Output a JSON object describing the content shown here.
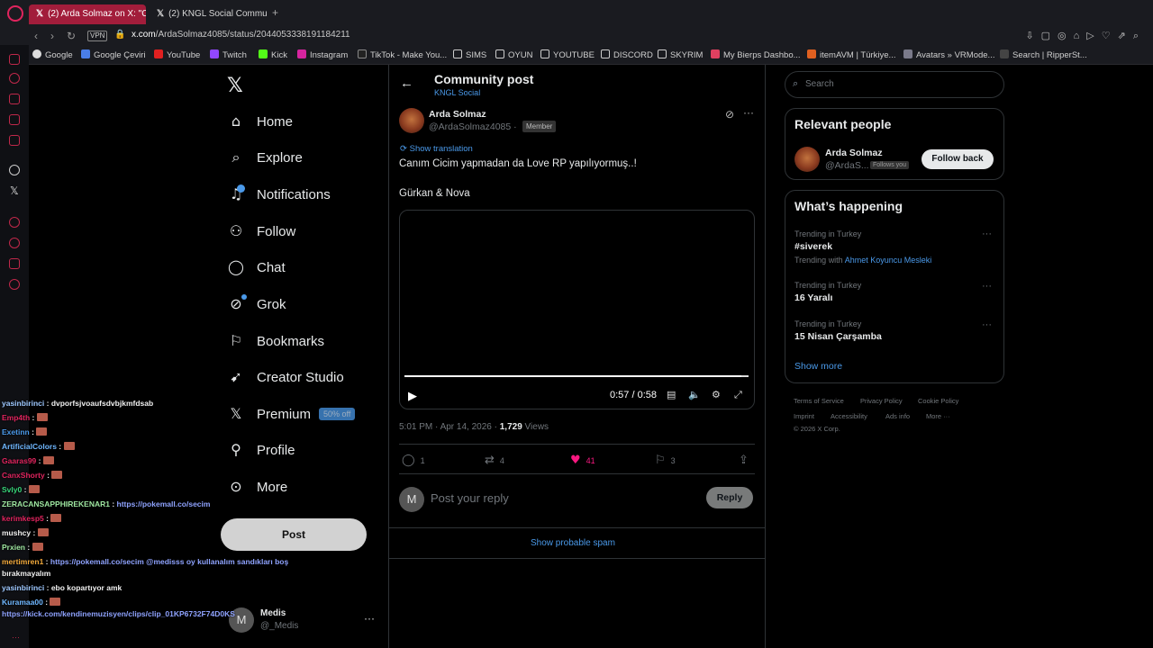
{
  "browser": {
    "tabs": [
      {
        "label": "(2) Arda Solmaz on X: \"Ca",
        "active": true
      },
      {
        "label": "(2) KNGL Social Communi",
        "active": false
      }
    ],
    "vpn": "VPN",
    "url_host": "x.com",
    "url_path": "/ArdaSolmaz4085/status/2044053338191184211",
    "bookmarks": [
      "Google",
      "Google Çeviri",
      "YouTube",
      "Twitch",
      "Kick",
      "Instagram",
      "TikTok - Make You...",
      "SIMS",
      "OYUN",
      "YOUTUBE",
      "DISCORD",
      "SKYRIM",
      "My Bierps Dashbo...",
      "itemAVM | Türkiye...",
      "Avatars » VRMode...",
      "Search | RipperSt..."
    ]
  },
  "nav": {
    "items": [
      "Home",
      "Explore",
      "Notifications",
      "Follow",
      "Chat",
      "Grok",
      "Bookmarks",
      "Creator Studio",
      "Premium",
      "Profile",
      "More"
    ],
    "premium_badge": "50% off",
    "post_button": "Post",
    "account_initial": "M",
    "account_name": "Medis",
    "account_handle": "@_Medis"
  },
  "post": {
    "header_title": "Community post",
    "header_sub": "KNGL Social",
    "author_name": "Arda Solmaz",
    "author_handle": "@ArdaSolmaz4085 ·",
    "member_badge": "Member",
    "show_translation": "Show translation",
    "text1": "Canım Cicim yapmadan da Love RP yapılıyormuş..!",
    "text2": "Gürkan & Nova",
    "video_time": "0:57 / 0:58",
    "video_progress": 0.98,
    "timestamp": "5:01 PM · Apr 14, 2026 ·",
    "views_count": "1,729",
    "views_label": "Views",
    "replies": "1",
    "reposts": "4",
    "likes": "41",
    "bookmarks": "3",
    "reply_initial": "M",
    "reply_placeholder": "Post your reply",
    "reply_button": "Reply",
    "show_spam": "Show probable spam"
  },
  "right": {
    "search_placeholder": "Search",
    "relevant_title": "Relevant people",
    "rp_name": "Arda Solmaz",
    "rp_handle": "@ArdaS...",
    "follows_you": "Follows you",
    "follow_back": "Follow back",
    "happening_title": "What’s happening",
    "trends": [
      {
        "category": "Trending in Turkey",
        "name": "#siverek",
        "with_label": "Trending with",
        "with_value": "Ahmet Koyuncu Mesleki"
      },
      {
        "category": "Trending in Turkey",
        "name": "16 Yaralı"
      },
      {
        "category": "Trending in Turkey",
        "name": "15 Nisan Çarşamba"
      }
    ],
    "show_more": "Show more",
    "footer": [
      "Terms of Service",
      "Privacy Policy",
      "Cookie Policy",
      "Imprint",
      "Accessibility",
      "Ads info",
      "More ···",
      "© 2026 X Corp."
    ]
  },
  "chat": [
    {
      "user": "yasinbirinci",
      "color": "#9ec8ff",
      "msg": "dvporfsjvoaufsdvbjkmfdsab"
    },
    {
      "user": "Emp4th",
      "color": "#e0245e",
      "msg": ""
    },
    {
      "user": "Exetinn",
      "color": "#4a99e9",
      "msg": ""
    },
    {
      "user": "ArtificialColors",
      "color": "#6fb7ff",
      "msg": ""
    },
    {
      "user": "Gaaras99",
      "color": "#e0245e",
      "msg": ""
    },
    {
      "user": "CanxShorty",
      "color": "#e0245e",
      "msg": ""
    },
    {
      "user": "Svly0",
      "color": "#37d67a",
      "msg": ""
    },
    {
      "user": "ZERACANSAPPHIREKENAR1",
      "color": "#9ee6a0",
      "msg": "https://pokemall.co/secim"
    },
    {
      "user": "kerimkesp5",
      "color": "#e0245e",
      "msg": ""
    },
    {
      "user": "mushcy",
      "color": "#f0f0f0",
      "msg": ""
    },
    {
      "user": "Prxien",
      "color": "#9ee6a0",
      "msg": ""
    },
    {
      "user": "mertimren1",
      "color": "#f2a93b",
      "msg": "https://pokemall.co/secim @medisss oy kullanalım sandıkları boş"
    },
    {
      "user": "",
      "color": "#f0f0f0",
      "msg": "bırakmayalım"
    },
    {
      "user": "yasinbirinci",
      "color": "#9ec8ff",
      "msg": "ebo kopartıyor amk"
    },
    {
      "user": "Kuramaa00",
      "color": "#6fb7ff",
      "msg": ""
    },
    {
      "user": "",
      "color": "#f0f0f0",
      "msg": "https://kick.com/kendinemuzisyen/clips/clip_01KP6732F74D0KS"
    }
  ]
}
